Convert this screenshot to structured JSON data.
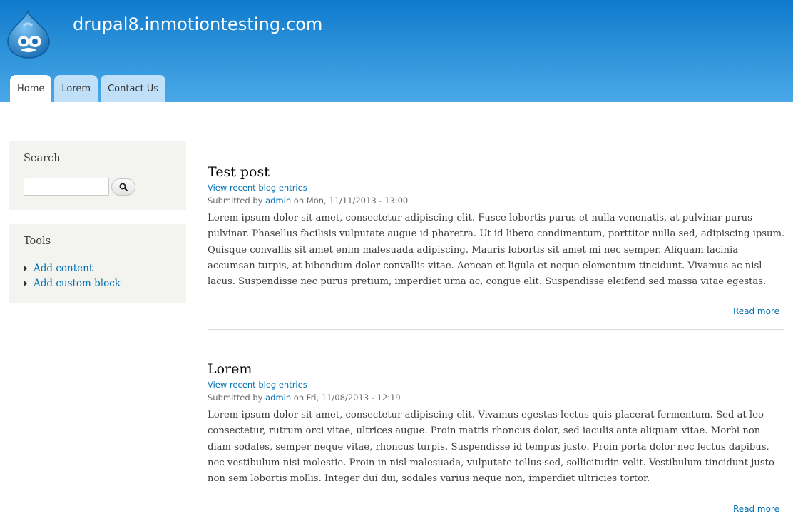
{
  "site": {
    "name": "drupal8.inmotiontesting.com"
  },
  "nav": {
    "tabs": [
      {
        "label": "Home",
        "active": true
      },
      {
        "label": "Lorem",
        "active": false
      },
      {
        "label": "Contact Us",
        "active": false
      }
    ]
  },
  "sidebar": {
    "search": {
      "title": "Search",
      "input_value": "",
      "button_icon": "search-icon"
    },
    "tools": {
      "title": "Tools",
      "links": [
        "Add content",
        "Add custom block"
      ]
    }
  },
  "articles": [
    {
      "title": "Test post",
      "blog_link": "View recent blog entries",
      "submitted_prefix": "Submitted by ",
      "author": "admin",
      "submitted_suffix": " on Mon, 11/11/2013 - 13:00",
      "body": "Lorem ipsum dolor sit amet, consectetur adipiscing elit. Fusce lobortis purus et nulla venenatis, at pulvinar purus pulvinar. Phasellus facilisis vulputate augue id pharetra. Ut id libero condimentum, porttitor nulla sed, adipiscing ipsum. Quisque convallis sit amet enim malesuada adipiscing. Mauris lobortis sit amet mi nec semper. Aliquam lacinia accumsan turpis, at bibendum dolor convallis vitae. Aenean et ligula et neque elementum tincidunt. Vivamus ac nisl lacus. Suspendisse nec purus pretium, imperdiet urna ac, congue elit. Suspendisse eleifend sed massa vitae egestas.",
      "read_more": "Read more"
    },
    {
      "title": "Lorem",
      "blog_link": "View recent blog entries",
      "submitted_prefix": "Submitted by ",
      "author": "admin",
      "submitted_suffix": " on Fri, 11/08/2013 - 12:19",
      "body": "Lorem ipsum dolor sit amet, consectetur adipiscing elit. Vivamus egestas lectus quis placerat fermentum. Sed at leo consectetur, rutrum orci vitae, ultrices augue. Proin mattis rhoncus dolor, sed iaculis ante aliquam vitae. Morbi non diam sodales, semper neque vitae, rhoncus turpis. Suspendisse id tempus justo. Proin porta dolor nec lectus dapibus, nec vestibulum nisi molestie. Proin in nisl malesuada, vulputate tellus sed, sollicitudin velit. Vestibulum tincidunt justo non sem lobortis mollis. Integer dui dui, sodales varius neque non, imperdiet ultricies tortor.",
      "read_more": "Read more"
    }
  ],
  "colors": {
    "header_top": "#0f7acd",
    "header_bottom": "#4aa8e8",
    "link": "#0071b3",
    "tab_inactive": "#bfe0f8",
    "sidebar_bg": "#f3f3ef"
  }
}
